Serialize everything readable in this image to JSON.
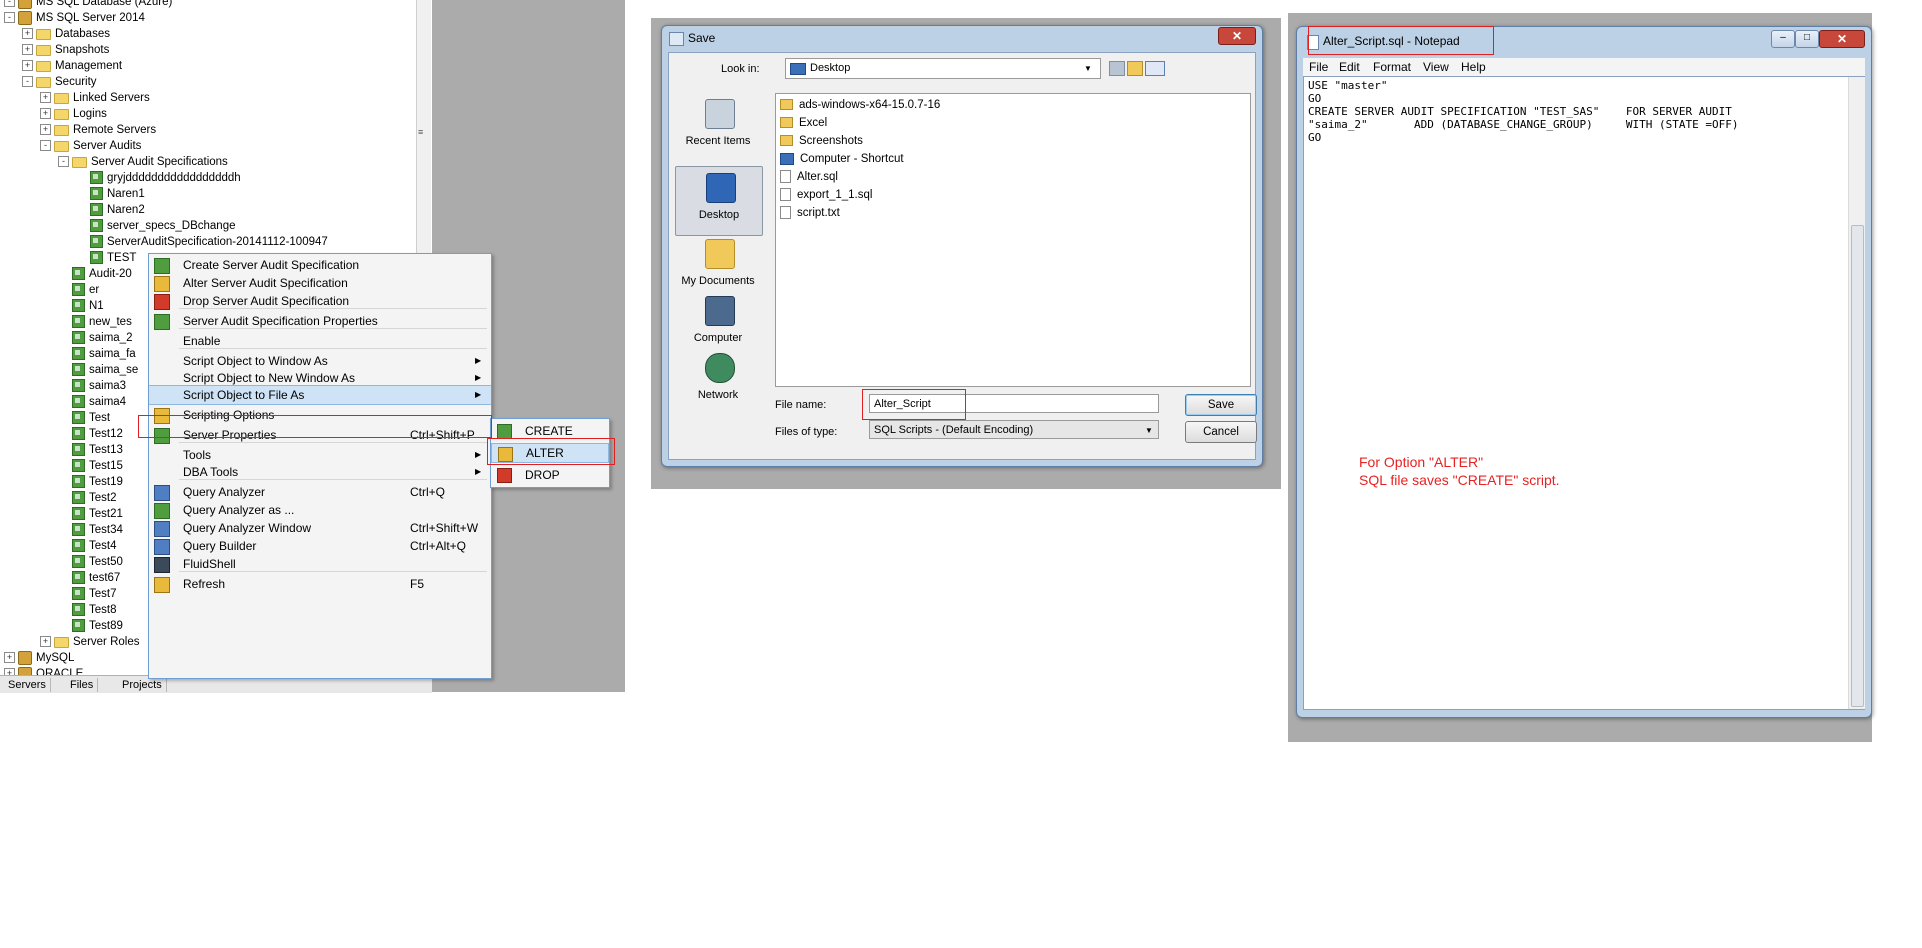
{
  "tree": {
    "rows": [
      {
        "label": "MS SQL Database (Azure)",
        "type": "db",
        "exp": "-"
      },
      {
        "label": "MS SQL Server 2014",
        "type": "db",
        "exp": "-"
      },
      {
        "label": "Databases",
        "type": "folder",
        "exp": "+"
      },
      {
        "label": "Snapshots",
        "type": "folder",
        "exp": "+"
      },
      {
        "label": "Management",
        "type": "folder",
        "exp": "+"
      },
      {
        "label": "Security",
        "type": "folder",
        "exp": "-"
      },
      {
        "label": "Linked Servers",
        "type": "folder",
        "exp": "+"
      },
      {
        "label": "Logins",
        "type": "folder",
        "exp": "+"
      },
      {
        "label": "Remote Servers",
        "type": "folder",
        "exp": "+"
      },
      {
        "label": "Server Audits",
        "type": "folder",
        "exp": "-"
      },
      {
        "label": "Server Audit Specifications",
        "type": "folder",
        "exp": "-"
      },
      {
        "label": "gryjdddddddddddddddddh",
        "type": "audit",
        "exp": ""
      },
      {
        "label": "Naren1",
        "type": "audit",
        "exp": ""
      },
      {
        "label": "Naren2",
        "type": "audit",
        "exp": ""
      },
      {
        "label": "server_specs_DBchange",
        "type": "audit",
        "exp": ""
      },
      {
        "label": "ServerAuditSpecification-20141112-100947",
        "type": "audit",
        "exp": ""
      },
      {
        "label": "TEST",
        "type": "audit",
        "exp": ""
      },
      {
        "label": "Audit-20",
        "type": "audit",
        "exp": ""
      },
      {
        "label": "er",
        "type": "audit",
        "exp": ""
      },
      {
        "label": "N1",
        "type": "audit",
        "exp": ""
      },
      {
        "label": "new_tes",
        "type": "audit",
        "exp": ""
      },
      {
        "label": "saima_2",
        "type": "audit",
        "exp": ""
      },
      {
        "label": "saima_fa",
        "type": "audit",
        "exp": ""
      },
      {
        "label": "saima_se",
        "type": "audit",
        "exp": ""
      },
      {
        "label": "saima3",
        "type": "audit",
        "exp": ""
      },
      {
        "label": "saima4",
        "type": "audit",
        "exp": ""
      },
      {
        "label": "Test",
        "type": "audit",
        "exp": ""
      },
      {
        "label": "Test12",
        "type": "audit",
        "exp": ""
      },
      {
        "label": "Test13",
        "type": "audit",
        "exp": ""
      },
      {
        "label": "Test15",
        "type": "audit",
        "exp": ""
      },
      {
        "label": "Test19",
        "type": "audit",
        "exp": ""
      },
      {
        "label": "Test2",
        "type": "audit",
        "exp": ""
      },
      {
        "label": "Test21",
        "type": "audit",
        "exp": ""
      },
      {
        "label": "Test34",
        "type": "audit",
        "exp": ""
      },
      {
        "label": "Test4",
        "type": "audit",
        "exp": ""
      },
      {
        "label": "Test50",
        "type": "audit",
        "exp": ""
      },
      {
        "label": "test67",
        "type": "audit",
        "exp": ""
      },
      {
        "label": "Test7",
        "type": "audit",
        "exp": ""
      },
      {
        "label": "Test8",
        "type": "audit",
        "exp": ""
      },
      {
        "label": "Test89",
        "type": "audit",
        "exp": ""
      },
      {
        "label": "Server Roles",
        "type": "folder",
        "exp": "+"
      },
      {
        "label": "MySQL",
        "type": "db",
        "exp": "+"
      },
      {
        "label": "ORACLE",
        "type": "db",
        "exp": "+"
      }
    ],
    "bottom_tabs": [
      "Servers",
      "Files",
      "Projects"
    ]
  },
  "context_menu": {
    "items": [
      {
        "label": "Create Server Audit Specification",
        "shortcut": "",
        "submenu": false,
        "icon": "audit-create-icon"
      },
      {
        "label": "Alter Server Audit Specification",
        "shortcut": "",
        "submenu": false,
        "icon": "audit-alter-icon"
      },
      {
        "label": "Drop Server Audit Specification",
        "shortcut": "",
        "submenu": false,
        "icon": "audit-drop-icon"
      },
      {
        "label": "Server Audit Specification Properties",
        "shortcut": "",
        "submenu": false,
        "icon": "properties-icon"
      },
      {
        "label": "Enable",
        "shortcut": "",
        "submenu": false,
        "icon": ""
      },
      {
        "label": "Script Object to Window As",
        "shortcut": "",
        "submenu": true,
        "icon": ""
      },
      {
        "label": "Script Object to New Window As",
        "shortcut": "",
        "submenu": true,
        "icon": ""
      },
      {
        "label": "Script Object to File As",
        "shortcut": "",
        "submenu": true,
        "icon": ""
      },
      {
        "label": "Scripting Options",
        "shortcut": "",
        "submenu": false,
        "icon": "scripting-options-icon"
      },
      {
        "label": "Server Properties",
        "shortcut": "Ctrl+Shift+P",
        "submenu": false,
        "icon": "server-properties-icon"
      },
      {
        "label": "Tools",
        "shortcut": "",
        "submenu": true,
        "icon": ""
      },
      {
        "label": "DBA Tools",
        "shortcut": "",
        "submenu": true,
        "icon": ""
      },
      {
        "label": "Query Analyzer",
        "shortcut": "Ctrl+Q",
        "submenu": false,
        "icon": "query-analyzer-icon"
      },
      {
        "label": "Query Analyzer as ...",
        "shortcut": "",
        "submenu": false,
        "icon": "query-analyzer-as-icon"
      },
      {
        "label": "Query Analyzer Window",
        "shortcut": "Ctrl+Shift+W",
        "submenu": false,
        "icon": "query-window-icon"
      },
      {
        "label": "Query Builder",
        "shortcut": "Ctrl+Alt+Q",
        "submenu": false,
        "icon": "query-builder-icon"
      },
      {
        "label": "FluidShell",
        "shortcut": "",
        "submenu": false,
        "icon": "fluidshell-icon"
      },
      {
        "label": "Refresh",
        "shortcut": "F5",
        "submenu": false,
        "icon": "refresh-icon"
      }
    ],
    "submenu": [
      "CREATE",
      "ALTER",
      "DROP"
    ]
  },
  "save_dialog": {
    "title": "Save",
    "close": "✕",
    "look_in_label": "Look in:",
    "look_in_value": "Desktop",
    "places": [
      "Recent Items",
      "Desktop",
      "My Documents",
      "Computer",
      "Network"
    ],
    "files": [
      {
        "name": "ads-windows-x64-15.0.7-16",
        "kind": "folder"
      },
      {
        "name": "Excel",
        "kind": "folder"
      },
      {
        "name": "Screenshots",
        "kind": "folder"
      },
      {
        "name": "Computer - Shortcut",
        "kind": "shortcut"
      },
      {
        "name": "Alter.sql",
        "kind": "doc"
      },
      {
        "name": "export_1_1.sql",
        "kind": "doc"
      },
      {
        "name": "script.txt",
        "kind": "doc"
      }
    ],
    "file_name_label": "File name:",
    "file_name_value": "Alter_Script",
    "file_type_label": "Files of type:",
    "file_type_value": "SQL Scripts - (Default Encoding)",
    "save_label": "Save",
    "cancel_label": "Cancel"
  },
  "notepad": {
    "title": "Alter_Script.sql - Notepad",
    "menu": [
      "File",
      "Edit",
      "Format",
      "View",
      "Help"
    ],
    "content": "USE \"master\"\nGO\nCREATE SERVER AUDIT SPECIFICATION \"TEST_SAS\"    FOR SERVER AUDIT\n\"saima_2\"       ADD (DATABASE_CHANGE_GROUP)     WITH (STATE =OFF)\nGO",
    "note_line1": "For Option \"ALTER\"",
    "note_line2": "SQL file saves \"CREATE\" script."
  },
  "colors": {
    "highlight": "#cfe3f7",
    "annotation_red": "#e82222",
    "menu_border": "#6e9ed3"
  }
}
